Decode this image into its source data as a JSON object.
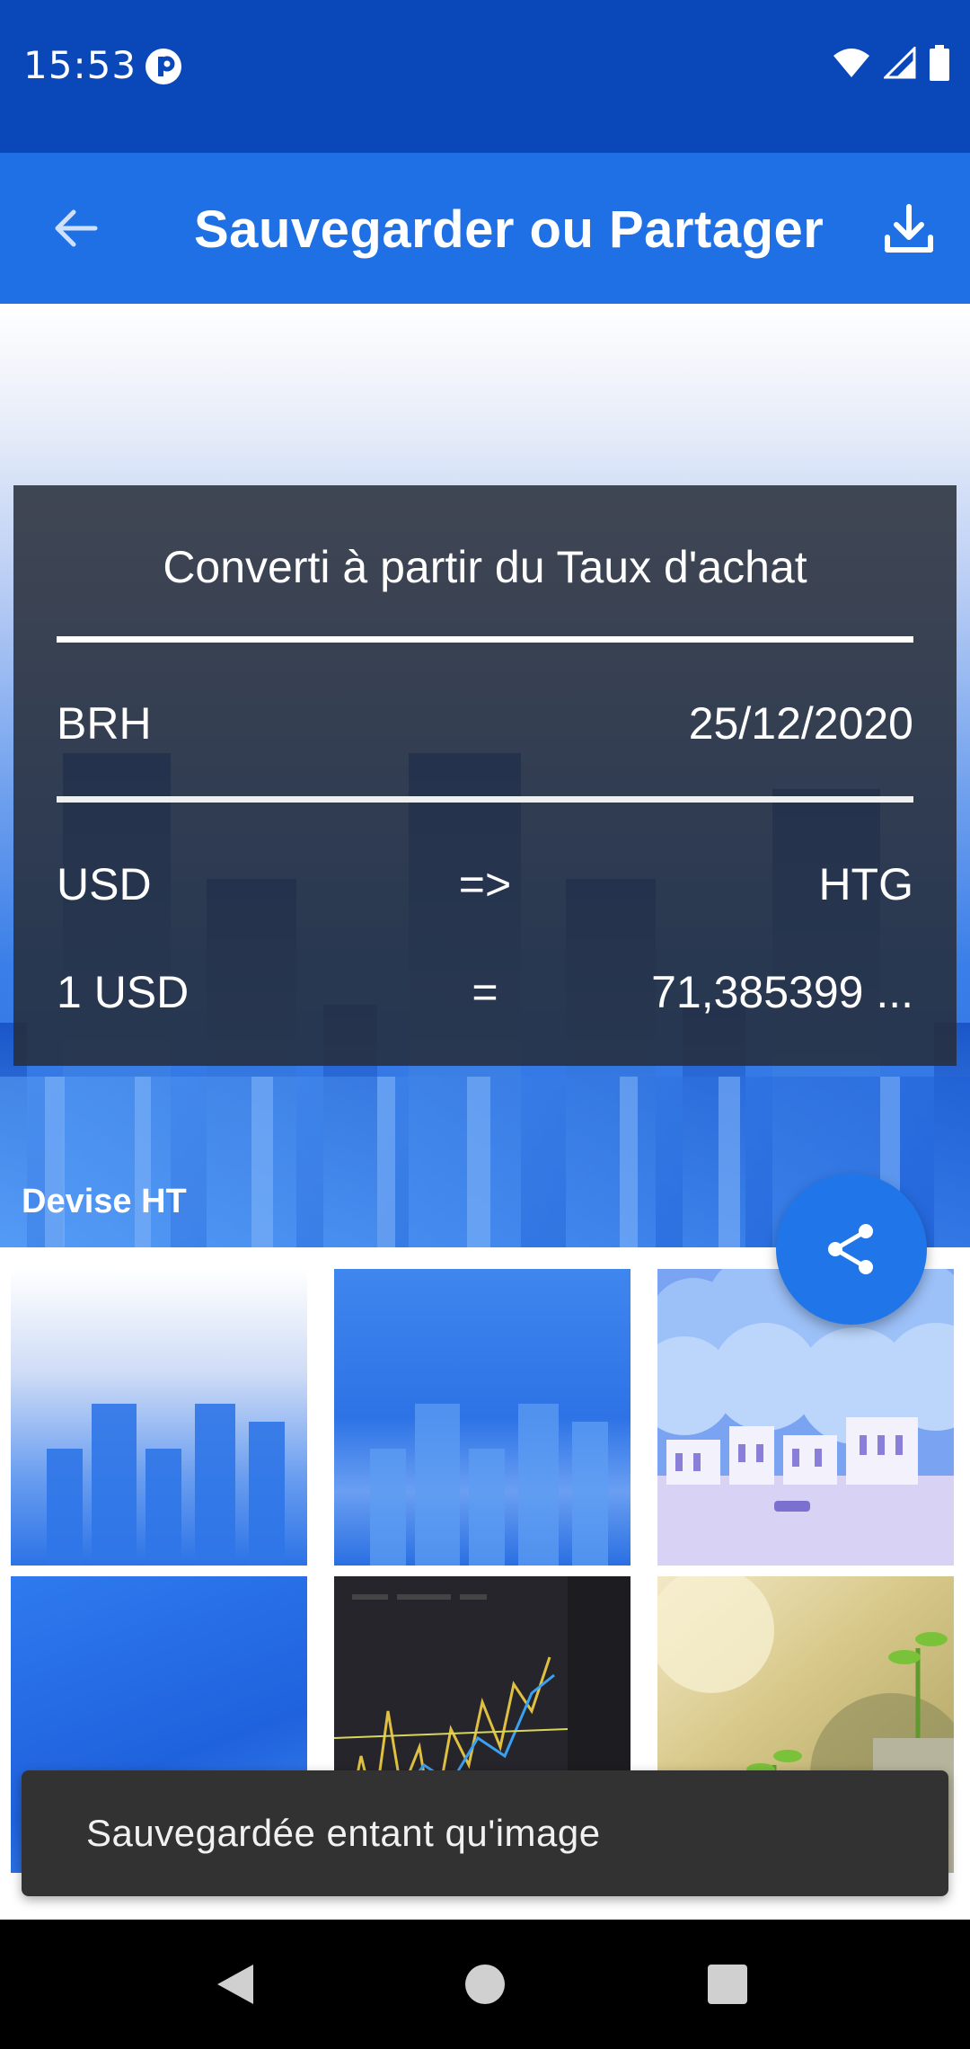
{
  "status_bar": {
    "time": "15:53",
    "icons": [
      "app-notification-icon",
      "wifi-icon",
      "signal-icon",
      "battery-icon"
    ]
  },
  "app_bar": {
    "title": "Sauvegarder ou Partager",
    "back_icon": "arrow-back-icon",
    "download_icon": "download-icon",
    "background": "#1e70e4"
  },
  "card": {
    "title": "Converti à partir du Taux d'achat",
    "source": "BRH",
    "date": "25/12/2020",
    "from_currency": "USD",
    "arrow": "=>",
    "to_currency": "HTG",
    "amount": "1 USD",
    "equals": "=",
    "result": "71,385399 ..."
  },
  "hero": {
    "brand": "Devise HT"
  },
  "share_fab": {
    "icon": "share-icon",
    "color": "#2076e8"
  },
  "thumbnails": [
    {
      "name": "blue-bars-light"
    },
    {
      "name": "blue-bars-dark"
    },
    {
      "name": "city-clouds"
    },
    {
      "name": "blue-gradient"
    },
    {
      "name": "stock-chart"
    },
    {
      "name": "plant-coins"
    }
  ],
  "snackbar": {
    "message": "Sauvegardée entant qu'image"
  },
  "nav_bar": {
    "icons": [
      "back-triangle-icon",
      "home-circle-icon",
      "recents-square-icon"
    ]
  }
}
